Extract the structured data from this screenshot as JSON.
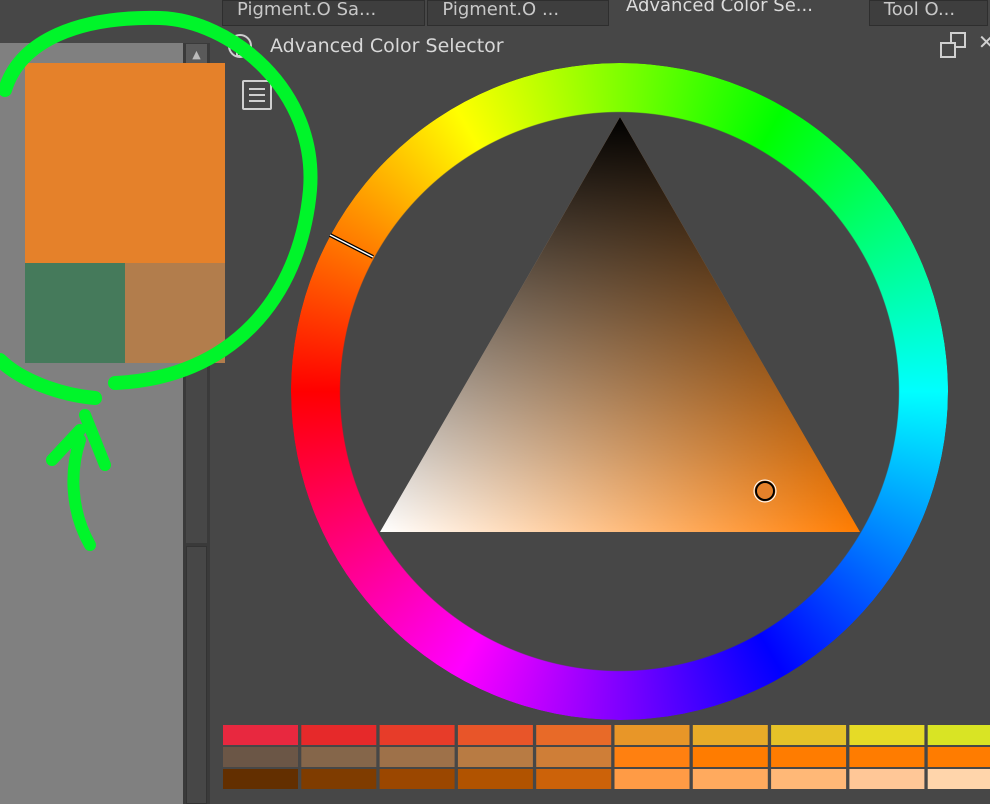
{
  "tabs": [
    {
      "label": "Pigment.O Sa..."
    },
    {
      "label": "Pigment.O ..."
    },
    {
      "label": "Advanced Color Se...",
      "active": true
    },
    {
      "label": "Tool O..."
    }
  ],
  "docker": {
    "title": "Advanced Color Selector"
  },
  "colors": {
    "foreground": "#e5812a",
    "background": "#457a5b",
    "blend": "#b27d4c",
    "selected": "#e5812a",
    "annotation": "#00f52a"
  },
  "selector": {
    "hue_deg": 30,
    "hue_indicator": "orange"
  },
  "swatches": [
    [
      "#e8283f",
      "#e6292a",
      "#e73c29",
      "#e85529",
      "#e86a28",
      "#e89628",
      "#e8ab28",
      "#e6c228",
      "#e6db26",
      "#d9e424"
    ],
    [
      "#6b5646",
      "#85664a",
      "#9e7149",
      "#b87b43",
      "#cf7e37",
      "#ff8010",
      "#ff7c00",
      "#ff7c00",
      "#ff7c00",
      "#ff7c00"
    ],
    [
      "#632f00",
      "#7f3c00",
      "#9b4700",
      "#b15300",
      "#cc6209",
      "#ff9b45",
      "#ffaa5e",
      "#ffb877",
      "#ffc797",
      "#ffd5ab"
    ]
  ]
}
